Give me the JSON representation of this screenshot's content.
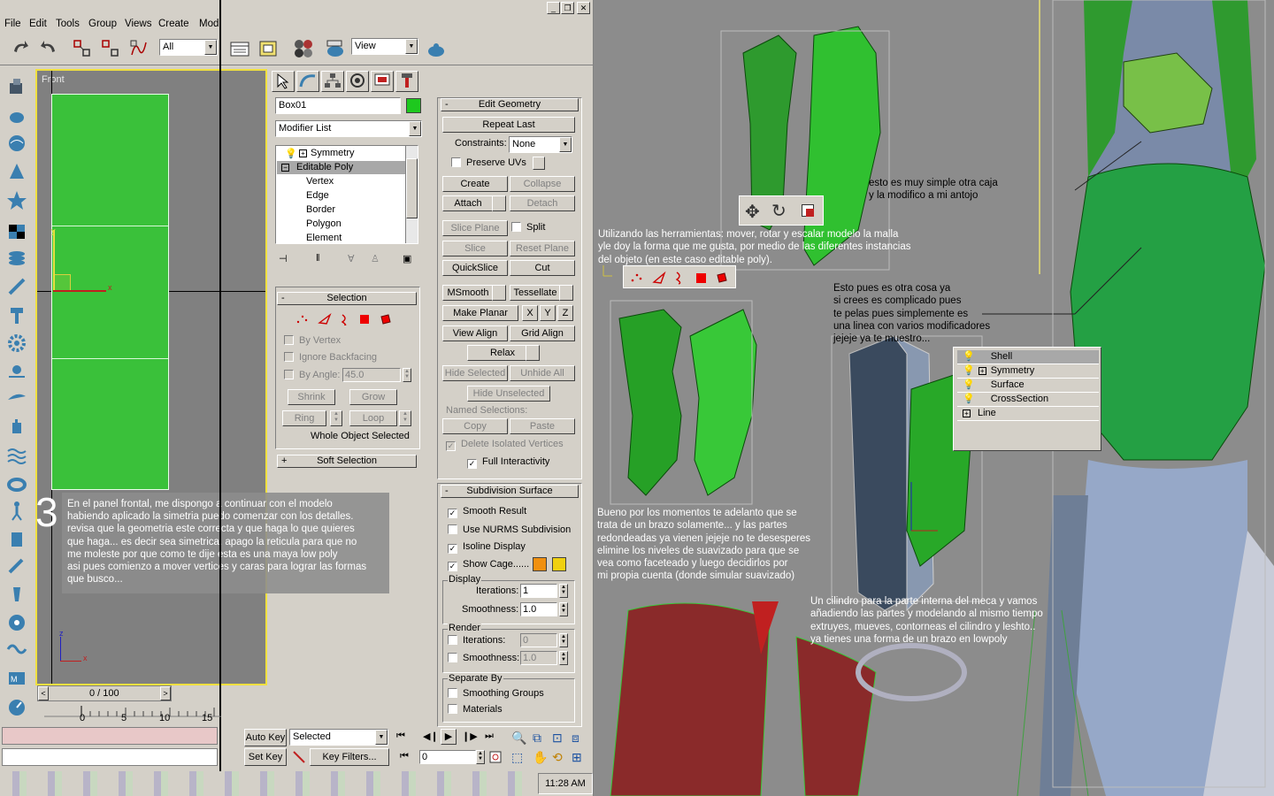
{
  "app": {
    "window_buttons": [
      "_",
      "❐",
      "✕"
    ],
    "menu": [
      "File",
      "Edit",
      "Tools",
      "Group",
      "Views",
      "Create",
      "Modi"
    ]
  },
  "toolbar": {
    "selection_filter": "All",
    "ref_coord": "View"
  },
  "viewport": {
    "label": "Front",
    "axis_x": "x",
    "axis_y": "y",
    "axis_z": "z",
    "step_number": "3",
    "tutorial_text": "En el panel frontal, me dispongo a continuar con el modelo\nhabiendo aplicado la simetria puedo comenzar con los detalles.\nrevisa que la geometria este correcta y que haga lo que quieres\nque haga... es decir sea simetrica. apago la reticula para que no\nme moleste por que como te dije esta es una maya low poly\nasi pues comienzo a mover vertices y caras para lograr las formas\nque busco..."
  },
  "modify": {
    "object_name": "Box01",
    "object_color": "#1ec81e",
    "modifier_list": "Modifier List",
    "stack": [
      "Symmetry",
      "Editable Poly",
      "Vertex",
      "Edge",
      "Border",
      "Polygon",
      "Element"
    ],
    "selection": {
      "title": "Selection",
      "by_vertex": "By Vertex",
      "ignore_backfacing": "Ignore Backfacing",
      "by_angle": "By Angle:",
      "angle_value": "45.0",
      "shrink": "Shrink",
      "grow": "Grow",
      "ring": "Ring",
      "loop": "Loop",
      "status": "Whole Object Selected"
    },
    "soft_selection": "Soft Selection"
  },
  "edit_geometry": {
    "title": "Edit Geometry",
    "repeat_last": "Repeat Last",
    "constraints_label": "Constraints:",
    "constraints_value": "None",
    "preserve_uvs": "Preserve UVs",
    "create": "Create",
    "collapse": "Collapse",
    "attach": "Attach",
    "detach": "Detach",
    "slice_plane": "Slice Plane",
    "split": "Split",
    "slice": "Slice",
    "reset_plane": "Reset Plane",
    "quickslice": "QuickSlice",
    "cut": "Cut",
    "msmooth": "MSmooth",
    "tessellate": "Tessellate",
    "make_planar": "Make Planar",
    "x": "X",
    "y": "Y",
    "z": "Z",
    "view_align": "View Align",
    "grid_align": "Grid Align",
    "relax": "Relax",
    "hide_selected": "Hide Selected",
    "unhide_all": "Unhide All",
    "hide_unselected": "Hide Unselected",
    "named_selections": "Named Selections:",
    "copy": "Copy",
    "paste": "Paste",
    "delete_isolated": "Delete Isolated Vertices",
    "full_interactivity": "Full Interactivity"
  },
  "subdivision": {
    "title": "Subdivision Surface",
    "smooth_result": "Smooth Result",
    "use_nurms": "Use NURMS Subdivision",
    "isoline": "Isoline Display",
    "show_cage": "Show Cage......",
    "cage_color1": "#f09010",
    "cage_color2": "#f0d010",
    "display": "Display",
    "iterations": "Iterations:",
    "iter_value": "1",
    "smoothness": "Smoothness:",
    "smooth_value": "1.0",
    "render": "Render",
    "r_iter_value": "0",
    "r_smooth_value": "1.0",
    "separate_by": "Separate By",
    "smoothing_groups": "Smoothing Groups",
    "materials": "Materials"
  },
  "bottom": {
    "frame": "0 / 100",
    "ticks": [
      "0",
      "5",
      "10",
      "15"
    ],
    "auto_key": "Auto Key",
    "set_key": "Set Key",
    "key_mode": "Selected",
    "key_filters": "Key Filters...",
    "frame_value": "0",
    "clock": "11:28 AM"
  },
  "notes": {
    "tools": "Utilizando las herramientas: mover, rotar y escalar modelo la malla\nyle doy la forma que me gusta, por medio de las diferentes instancias\ndel objeto (en este caso editable poly).",
    "box": "esto es muy simple otra caja\ny la modifico a mi antojo",
    "line": "Esto pues es otra cosa ya\nsi crees es complicado pues\nte pelas pues simplemente es\nuna linea con varios modificadores\njejeje ya te muestro...",
    "smooth": "Bueno por los momentos te adelanto que se\ntrata de un brazo solamente... y las partes\nredondeadas ya vienen jejeje no te desesperes\nelimine los niveles de suavizado para que se\nvea como faceteado y luego decidirlos por\nmi propia cuenta (donde simular suavizado)",
    "cylinder": "Un cilindro para la parte interna del meca y vamos\nañadiendo las partes y modelando al mismo tiempo\nextruyes, mueves, contorneas el cilindro y leshto..\nya tienes una forma de un brazo en lowpoly"
  },
  "popup_stack": [
    "Shell",
    "Symmetry",
    "Surface",
    "CrossSection",
    "Line"
  ]
}
